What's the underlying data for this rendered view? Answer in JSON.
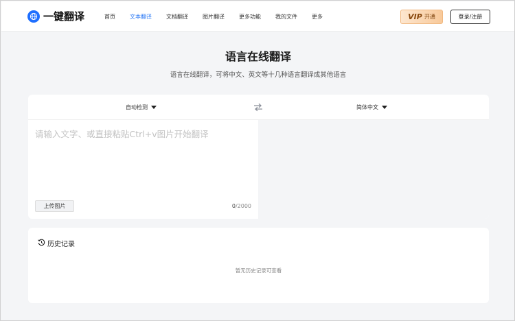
{
  "header": {
    "logo_text": "一键翻译",
    "nav": [
      {
        "label": "首页",
        "active": false
      },
      {
        "label": "文本翻译",
        "active": true
      },
      {
        "label": "文档翻译",
        "active": false
      },
      {
        "label": "图片翻译",
        "active": false
      },
      {
        "label": "更多功能",
        "active": false
      },
      {
        "label": "我的文件",
        "active": false
      },
      {
        "label": "更多",
        "active": false
      }
    ],
    "vip_label": "VIP",
    "vip_action": "开通",
    "login_label": "登录/注册"
  },
  "hero": {
    "title": "语言在线翻译",
    "subtitle": "语言在线翻译，可将中文、英文等十几种语言翻译成其他语言"
  },
  "translator": {
    "source_language": "自动检测",
    "target_language": "简体中文",
    "input_placeholder": "请输入文字、或直接粘贴Ctrl+v图片开始翻译",
    "upload_label": "上传图片",
    "char_count_current": "0",
    "char_count_max": "/2000"
  },
  "history": {
    "title": "历史记录",
    "empty_text": "暂无历史记录可查看"
  },
  "colors": {
    "accent": "#2f7cf6",
    "logo": "#1e6fff",
    "page_bg": "#f4f5f7"
  }
}
